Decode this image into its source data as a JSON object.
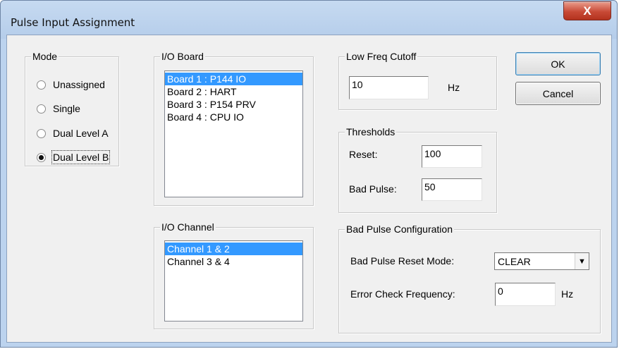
{
  "window": {
    "title": "Pulse Input Assignment",
    "close_label": "X"
  },
  "mode": {
    "legend": "Mode",
    "options": [
      {
        "label": "Unassigned",
        "checked": false
      },
      {
        "label": "Single",
        "checked": false
      },
      {
        "label": "Dual Level A",
        "checked": false
      },
      {
        "label": "Dual Level B",
        "checked": true
      }
    ]
  },
  "io_board": {
    "legend": "I/O Board",
    "items": [
      {
        "label": "Board 1 : P144 IO",
        "selected": true
      },
      {
        "label": "Board 2 : HART",
        "selected": false
      },
      {
        "label": "Board 3 : P154 PRV",
        "selected": false
      },
      {
        "label": "Board 4 : CPU IO",
        "selected": false
      }
    ]
  },
  "io_channel": {
    "legend": "I/O Channel",
    "items": [
      {
        "label": "Channel 1 & 2",
        "selected": true
      },
      {
        "label": "Channel 3 & 4",
        "selected": false
      }
    ]
  },
  "low_freq": {
    "legend": "Low Freq Cutoff",
    "value": "10",
    "unit": "Hz"
  },
  "thresholds": {
    "legend": "Thresholds",
    "reset_label": "Reset:",
    "reset_value": "100",
    "bad_pulse_label": "Bad Pulse:",
    "bad_pulse_value": "50"
  },
  "bad_pulse_config": {
    "legend": "Bad Pulse Configuration",
    "reset_mode_label": "Bad Pulse Reset Mode:",
    "reset_mode_value": "CLEAR",
    "error_freq_label": "Error Check Frequency:",
    "error_freq_value": "0",
    "error_freq_unit": "Hz"
  },
  "buttons": {
    "ok": "OK",
    "cancel": "Cancel"
  },
  "colors": {
    "selection": "#3399ff",
    "titlebar": "#bcd3ee",
    "close_button": "#c84a36"
  }
}
